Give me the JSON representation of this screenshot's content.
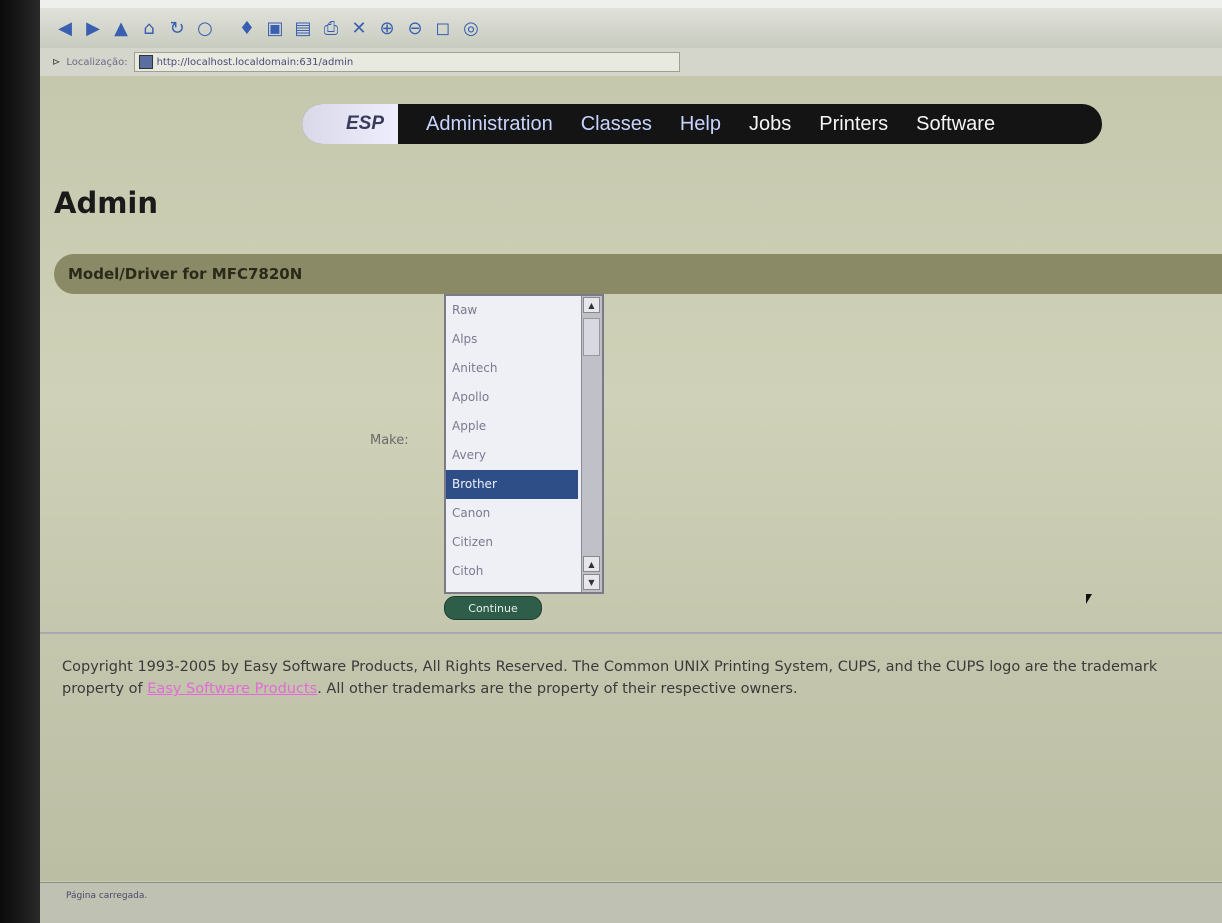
{
  "browser": {
    "toolbar_icons": [
      "back-icon",
      "forward-icon",
      "up-icon",
      "home-icon",
      "reload-icon",
      "stop-icon",
      "bookmark-icon",
      "copy-icon",
      "paste-icon",
      "print-icon",
      "find-icon",
      "zoom-in-icon",
      "zoom-out-icon",
      "window-icon",
      "extra-icon"
    ],
    "location_label": "Localização:",
    "url": "http://localhost.localdomain:631/admin"
  },
  "nav": {
    "brand": "ESP",
    "items": [
      "Administration",
      "Classes",
      "Help",
      "Jobs",
      "Printers",
      "Software"
    ]
  },
  "page": {
    "title": "Admin",
    "section_title": "Model/Driver for MFC7820N",
    "make_label": "Make:",
    "make_options": [
      "Raw",
      "Alps",
      "Anitech",
      "Apollo",
      "Apple",
      "Avery",
      "Brother",
      "Canon",
      "Citizen",
      "Citoh"
    ],
    "selected_make": "Brother",
    "continue_label": "Continue"
  },
  "footer": {
    "text_before_link": "Copyright 1993-2005 by Easy Software Products, All Rights Reserved. The Common UNIX Printing System, CUPS, and the CUPS logo are the trademark property of ",
    "link_text": "Easy Software Products",
    "text_after_link": ". All other trademarks are the property of their respective owners."
  },
  "status": {
    "text": "Página carregada."
  },
  "colors": {
    "nav_bg": "#141414",
    "section_bar": "#8b8a66",
    "selected_item": "#2e4e88",
    "continue_button": "#2e5e4a",
    "footer_link": "#e36ad8"
  }
}
